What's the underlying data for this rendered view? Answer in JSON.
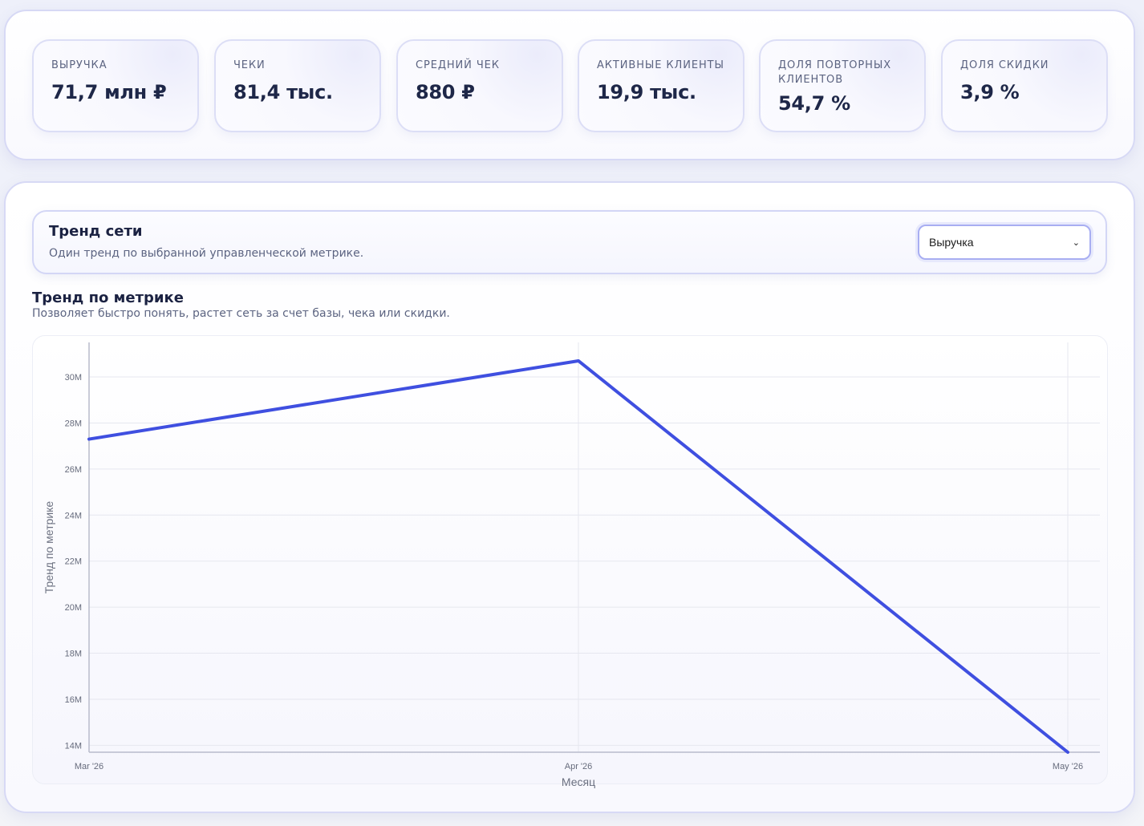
{
  "kpis": [
    {
      "label": "Выручка",
      "value": "71,7 млн ₽"
    },
    {
      "label": "Чеки",
      "value": "81,4 тыс."
    },
    {
      "label": "Средний чек",
      "value": "880 ₽"
    },
    {
      "label": "Активные клиенты",
      "value": "19,9 тыс."
    },
    {
      "label": "Доля повторных клиентов",
      "value": "54,7 %"
    },
    {
      "label": "Доля скидки",
      "value": "3,9 %"
    }
  ],
  "trend": {
    "title": "Тренд сети",
    "subtitle": "Один тренд по выбранной управленческой метрике.",
    "select_value": "Выручка"
  },
  "chart_section": {
    "title": "Тренд по метрике",
    "description": "Позволяет быстро понять, растет сеть за счет базы, чека или скидки."
  },
  "colors": {
    "line": "#3f4fe0",
    "grid": "#e6e7ef",
    "axis": "#b9bccb"
  },
  "chart_data": {
    "type": "line",
    "x": [
      "Mar '26",
      "Apr '26",
      "May '26"
    ],
    "series": [
      {
        "values": [
          27300000,
          30700000,
          13700000
        ]
      }
    ],
    "xlabel": "Месяц",
    "ylabel": "Тренд по метрике",
    "ylim": [
      13700000,
      31500000
    ],
    "yticks": [
      14000000,
      16000000,
      18000000,
      20000000,
      22000000,
      24000000,
      26000000,
      28000000,
      30000000
    ],
    "ytick_labels": [
      "14M",
      "16M",
      "18M",
      "20M",
      "22M",
      "24M",
      "26M",
      "28M",
      "30M"
    ],
    "grid": true
  }
}
